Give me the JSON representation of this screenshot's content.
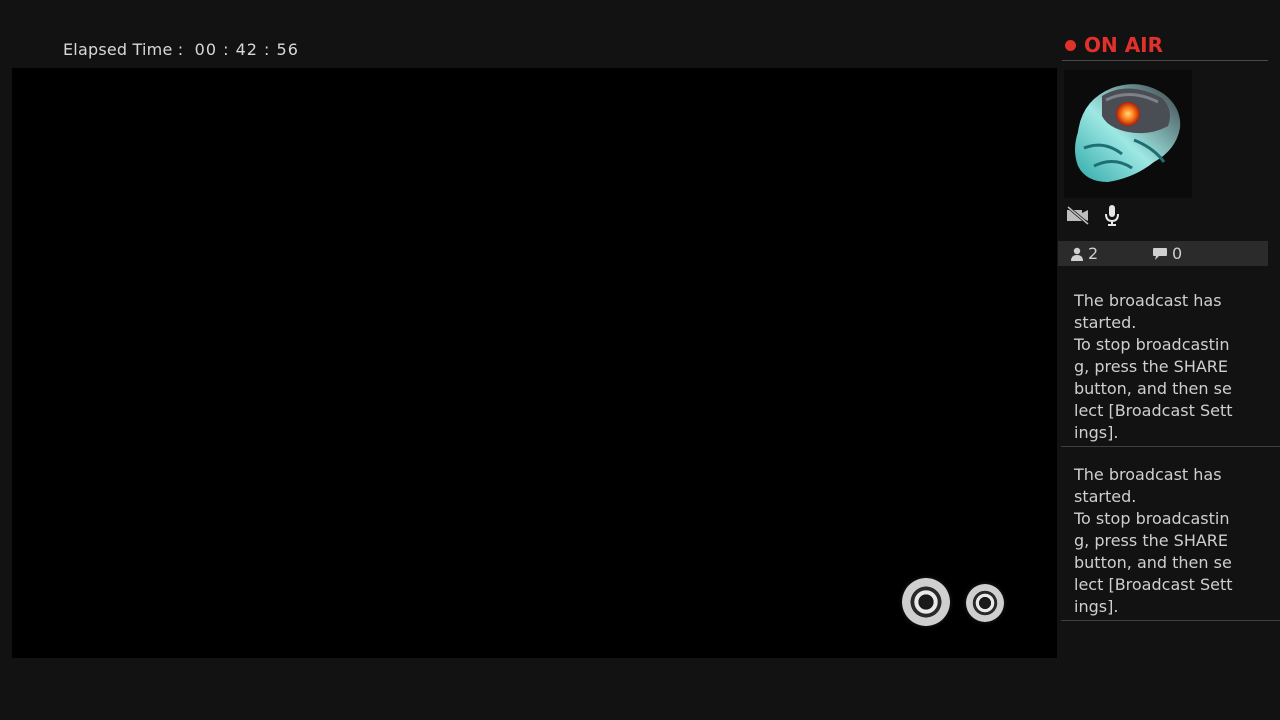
{
  "header": {
    "elapsed_label": "Elapsed Time :",
    "elapsed_time": "00 : 42 : 56"
  },
  "sidebar": {
    "status": "ON AIR",
    "status_color": "#e0312b",
    "avatar_icon": "helmet-avatar",
    "controls": [
      {
        "icon": "camera-off-icon"
      },
      {
        "icon": "microphone-icon"
      }
    ],
    "stats": {
      "viewers": "2",
      "comments": "0"
    },
    "messages": [
      "The broadcast has started.\nTo stop broadcasting, press the SHARE button, and then select [Broadcast Settings].",
      "The broadcast has started.\nTo stop broadcasting, press the SHARE button, and then select [Broadcast Settings]."
    ]
  }
}
